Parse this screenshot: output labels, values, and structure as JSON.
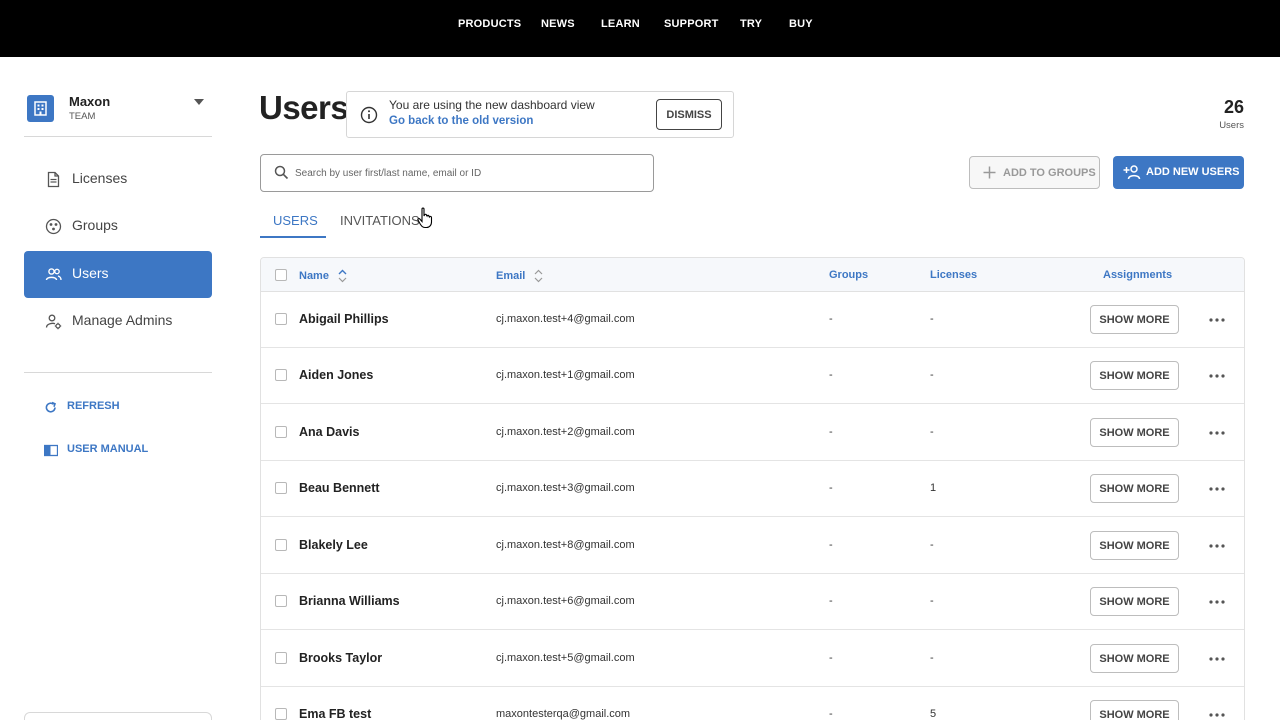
{
  "topnav": {
    "items": [
      {
        "label": "PRODUCTS"
      },
      {
        "label": "NEWS"
      },
      {
        "label": "LEARN"
      },
      {
        "label": "SUPPORT"
      },
      {
        "label": "TRY"
      },
      {
        "label": "BUY"
      }
    ]
  },
  "sidebar": {
    "team": {
      "name": "Maxon",
      "subtitle": "TEAM"
    },
    "items": [
      {
        "label": "Licenses",
        "icon": "document-icon"
      },
      {
        "label": "Groups",
        "icon": "groups-icon"
      },
      {
        "label": "Users",
        "icon": "users-icon",
        "active": true
      },
      {
        "label": "Manage Admins",
        "icon": "manage-admins-icon"
      }
    ],
    "links": [
      {
        "label": "REFRESH",
        "icon": "refresh-icon"
      },
      {
        "label": "USER MANUAL",
        "icon": "book-icon"
      }
    ]
  },
  "header": {
    "title": "Users",
    "banner": {
      "message": "You are using the new dashboard view",
      "link": "Go back to the old version",
      "dismiss_label": "DISMISS"
    },
    "user_count": "26",
    "user_count_label": "Users"
  },
  "search": {
    "placeholder": "Search by user first/last name, email or ID",
    "value": ""
  },
  "actions": {
    "add_to_groups": "ADD TO GROUPS",
    "add_new_users": "ADD NEW USERS"
  },
  "tabs": [
    {
      "label": "USERS",
      "active": true
    },
    {
      "label": "INVITATIONS",
      "active": false
    }
  ],
  "table": {
    "columns": {
      "name": "Name",
      "email": "Email",
      "groups": "Groups",
      "licenses": "Licenses",
      "assignments": "Assignments"
    },
    "show_more_label": "SHOW MORE",
    "rows": [
      {
        "name": "Abigail Phillips",
        "email": "cj.maxon.test+4@gmail.com",
        "groups": "-",
        "licenses": "-"
      },
      {
        "name": "Aiden Jones",
        "email": "cj.maxon.test+1@gmail.com",
        "groups": "-",
        "licenses": "-"
      },
      {
        "name": "Ana Davis",
        "email": "cj.maxon.test+2@gmail.com",
        "groups": "-",
        "licenses": "-"
      },
      {
        "name": "Beau Bennett",
        "email": "cj.maxon.test+3@gmail.com",
        "groups": "-",
        "licenses": "1"
      },
      {
        "name": "Blakely Lee",
        "email": "cj.maxon.test+8@gmail.com",
        "groups": "-",
        "licenses": "-"
      },
      {
        "name": "Brianna Williams",
        "email": "cj.maxon.test+6@gmail.com",
        "groups": "-",
        "licenses": "-"
      },
      {
        "name": "Brooks Taylor",
        "email": "cj.maxon.test+5@gmail.com",
        "groups": "-",
        "licenses": "-"
      },
      {
        "name": "Ema FB test",
        "email": "maxontesterqa@gmail.com",
        "groups": "-",
        "licenses": "5"
      }
    ]
  },
  "colors": {
    "accent": "#3d77c4",
    "nav_bg": "#000000"
  }
}
